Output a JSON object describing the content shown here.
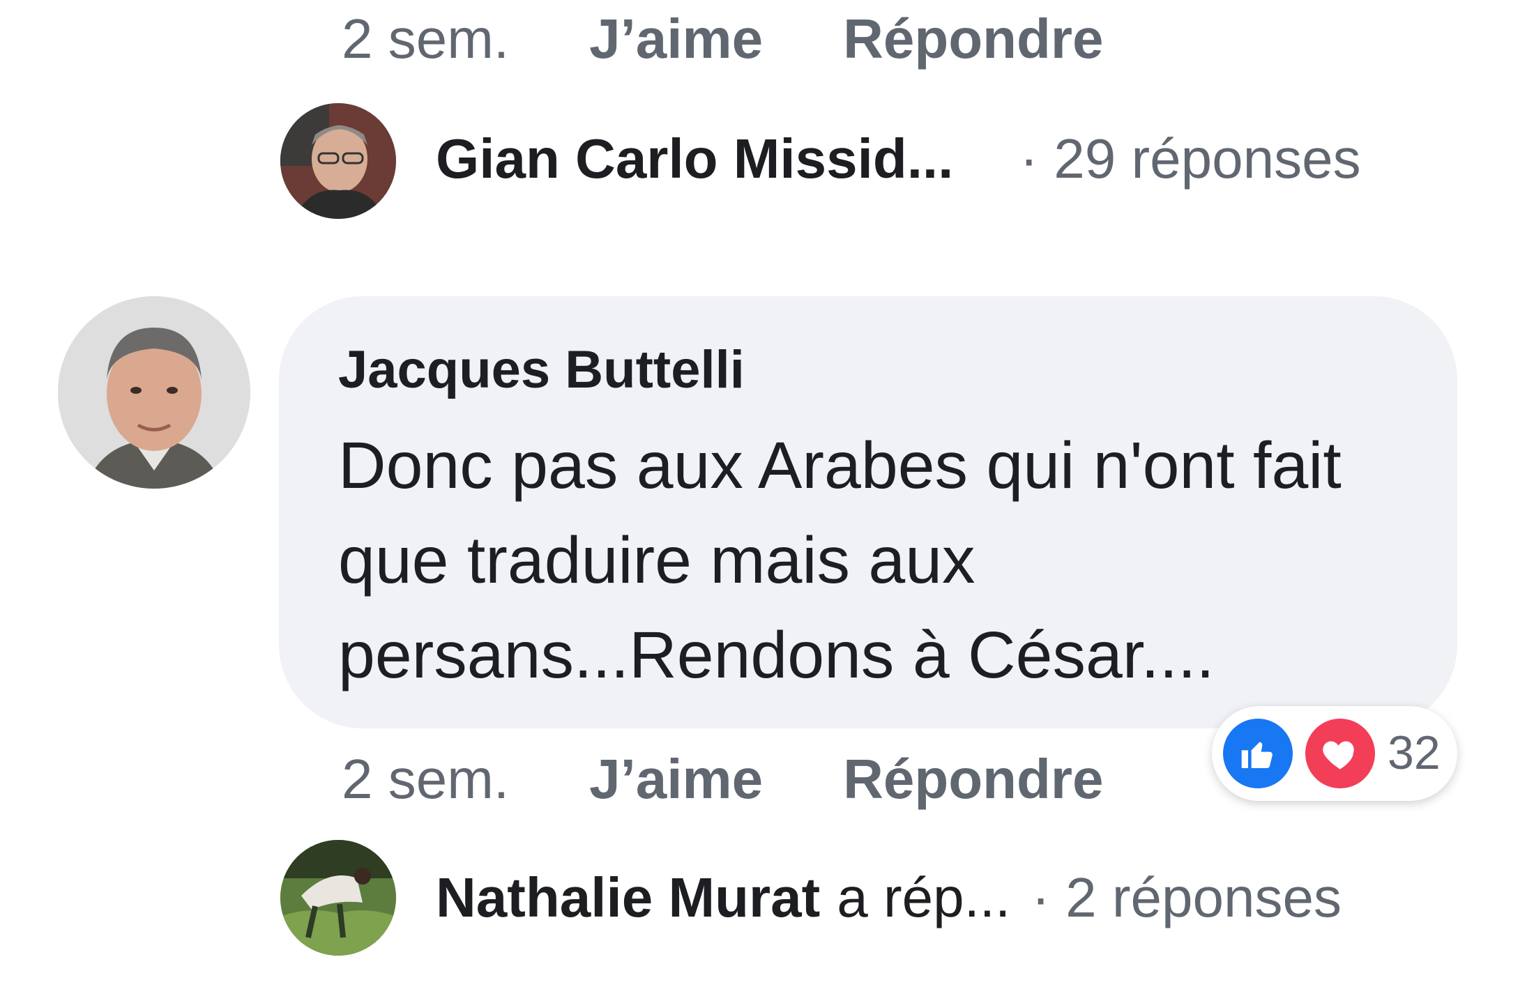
{
  "top_comment_meta": {
    "time": "2 sem.",
    "like": "J’aime",
    "reply": "Répondre"
  },
  "reply_thread_1": {
    "name": "Gian Carlo Missid...",
    "count": "· 29 réponses"
  },
  "comment": {
    "author": "Jacques Buttelli",
    "text": "Donc pas aux Arabes qui n'ont fait que traduire mais aux persans...Rendons à César....",
    "time": "2 sem.",
    "like": "J’aime",
    "reply": "Répondre",
    "reactions": {
      "icons": [
        "like-icon",
        "love-icon"
      ],
      "count": "32",
      "like_color": "#1877f2",
      "love_color": "#f33e58"
    }
  },
  "reply_thread_2": {
    "name": "Nathalie Murat",
    "verb": "a rép...",
    "count": "· 2 réponses"
  },
  "colors": {
    "bubble_bg": "#f0f2f5",
    "meta_text": "#606770",
    "primary_text": "#1c1e21"
  }
}
